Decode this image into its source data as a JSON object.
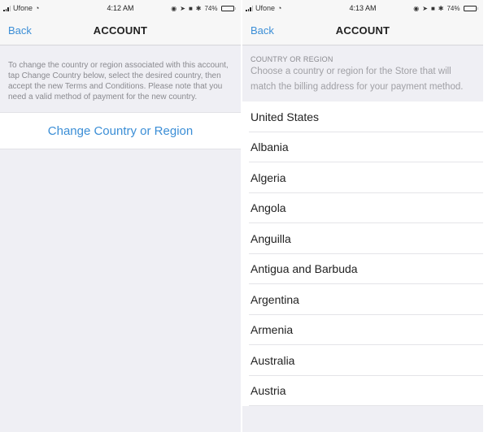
{
  "left_screen": {
    "status_bar": {
      "carrier": "Ufone",
      "time": "4:12 AM",
      "battery": "74%",
      "battery_level": 0.74
    },
    "nav": {
      "back_label": "Back",
      "title": "ACCOUNT"
    },
    "info_text": "To change the country or region associated with this account, tap Change Country below, select the desired country, then accept the new Terms and Conditions. Please note that you need a valid method of payment for the new country.",
    "action_label": "Change Country or Region"
  },
  "right_screen": {
    "status_bar": {
      "carrier": "Ufone",
      "time": "4:13 AM",
      "battery": "74%",
      "battery_level": 0.74
    },
    "nav": {
      "back_label": "Back",
      "title": "ACCOUNT"
    },
    "section_title": "COUNTRY OR REGION",
    "section_desc": "Choose a country or region for the Store that will match the billing address for your payment method.",
    "countries": [
      "United States",
      "Albania",
      "Algeria",
      "Angola",
      "Anguilla",
      "Antigua and Barbuda",
      "Argentina",
      "Armenia",
      "Australia",
      "Austria"
    ]
  },
  "colors": {
    "accent": "#3b8ed6",
    "background": "#efeff4",
    "text": "#222222",
    "secondary_text": "#8a8a8f"
  }
}
